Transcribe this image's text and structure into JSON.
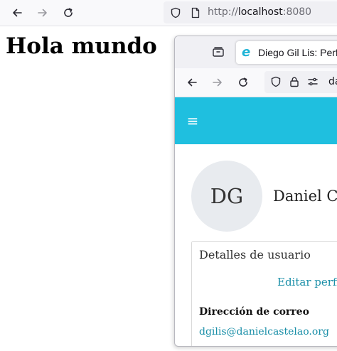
{
  "outer_browser": {
    "url_scheme": "http://",
    "url_host": "localhost",
    "url_port": ":8080"
  },
  "page": {
    "heading": "Hola mundo"
  },
  "popup": {
    "tab": {
      "favicon_glyph": "e",
      "title": "Diego Gil Lis: Perfil"
    },
    "url_text": "danielcastelao.org"
  },
  "app": {
    "menu_glyph": "≡",
    "avatar_initials": "DG",
    "user_name": "Daniel Castelao",
    "card": {
      "title": "Detalles de usuario",
      "edit_link": "Editar perfil",
      "email_label": "Dirección de correo",
      "email_value": "dgilis@danielcastelao.org"
    }
  },
  "colors": {
    "header": "#1fbfdf",
    "link": "#1a8fa8",
    "avatar_bg": "#e8ebef"
  }
}
